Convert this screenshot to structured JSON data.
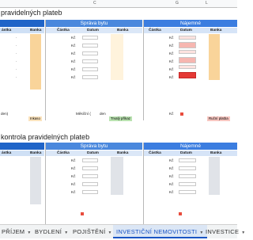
{
  "column_headers": {
    "col_l": "L",
    "col_g": "G",
    "col_c": "C"
  },
  "section1": {
    "title": "pravidelných plateb",
    "groups": [
      {
        "header": "",
        "color": "#1f64c8",
        "sub": [
          "ástka",
          "Banka"
        ]
      },
      {
        "header": "Správa bytu",
        "color": "#4a88dd",
        "sub": [
          "Částka",
          "Datum",
          "Banka"
        ]
      },
      {
        "header": "Nájemné",
        "color": "#3b7de0",
        "sub": [
          "Částka",
          "Datum",
          "Banka"
        ]
      }
    ],
    "kc_label": "Kč",
    "footer": {
      "left_label": "den)",
      "left_badge": "Inkaso",
      "mid_label": "Měsíční (",
      "mid_suffix": "den",
      "mid_badge": "Trvalý příkaz",
      "right_label": "Kč",
      "right_badge": "Ruční platba"
    }
  },
  "section2": {
    "title": "kontrola pravidelných plateb",
    "groups": [
      {
        "header": "",
        "color": "#1f64c8",
        "sub": [
          "ástka",
          "Banka"
        ]
      },
      {
        "header": "Správa bytu",
        "color": "#4a88dd",
        "sub": [
          "Částka",
          "Datum",
          "Banka"
        ]
      },
      {
        "header": "Nájemné",
        "color": "#3b7de0",
        "sub": [
          "Částka",
          "Datum",
          "Banka"
        ]
      }
    ],
    "kc_label": "Kč"
  },
  "tabs": [
    {
      "label": "PŘÍJEM",
      "active": false
    },
    {
      "label": "BYDLENÍ",
      "active": false
    },
    {
      "label": "POJIŠTĚNÍ",
      "active": false
    },
    {
      "label": "INVESTIČNÍ NEMOVITOSTI",
      "active": true
    },
    {
      "label": "INVESTICE",
      "active": false
    }
  ],
  "colors": {
    "orange_bank": "#f9d49a",
    "gray_bank": "#e0e3e8",
    "red_bar": "#e53935",
    "pink": "#f6b6b0",
    "green_badge": "#b9e2b0",
    "blue_badge": "#cde0f7",
    "red_badge": "#f7c6c0"
  }
}
